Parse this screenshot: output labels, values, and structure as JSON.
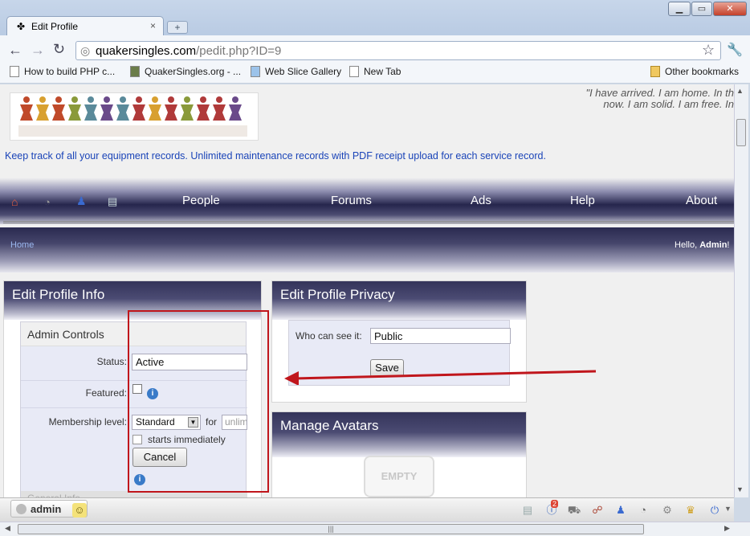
{
  "browser": {
    "tab_title": "Edit Profile",
    "tab_close": "×",
    "new_tab": "+",
    "url_domain": "quakersingles.com",
    "url_path": "/pedit.php?ID=9",
    "window_buttons": [
      "▁",
      "▭",
      "✕"
    ]
  },
  "bookmarks": {
    "items": [
      "How to build PHP c...",
      "QuakerSingles.org - ...",
      "Web Slice Gallery",
      "New Tab"
    ],
    "other": "Other bookmarks"
  },
  "header": {
    "quote_line1": "\"I have arrived. I am home. In th",
    "quote_line2": "now. I am solid. I am free. In",
    "tagline": "Keep track of all your equipment records. Unlimited maintenance records with PDF receipt upload for each service record."
  },
  "nav": {
    "items": [
      "People",
      "Forums",
      "Ads",
      "Help",
      "About"
    ]
  },
  "breadcrumb": {
    "home": "Home",
    "hello": "Hello,",
    "user": "Admin",
    "suffix": "!"
  },
  "edit_info": {
    "title": "Edit Profile Info",
    "section": "Admin Controls",
    "status_label": "Status:",
    "status_value": "Active",
    "featured_label": "Featured:",
    "membership_label": "Membership level:",
    "membership_value": "Standard",
    "for_label": "for",
    "for_value": "unlim",
    "starts_label": "starts immediately",
    "cancel": "Cancel",
    "general_info": "General Info"
  },
  "privacy": {
    "title": "Edit Profile Privacy",
    "who_label": "Who can see it:",
    "who_value": "Public",
    "save": "Save"
  },
  "avatars": {
    "title": "Manage Avatars",
    "empty": "EMPTY"
  },
  "statusbar": {
    "user": "admin",
    "notification_count": "2"
  },
  "colors": {
    "annotation_red": "#c0161c",
    "link_blue": "#1a44b8"
  }
}
